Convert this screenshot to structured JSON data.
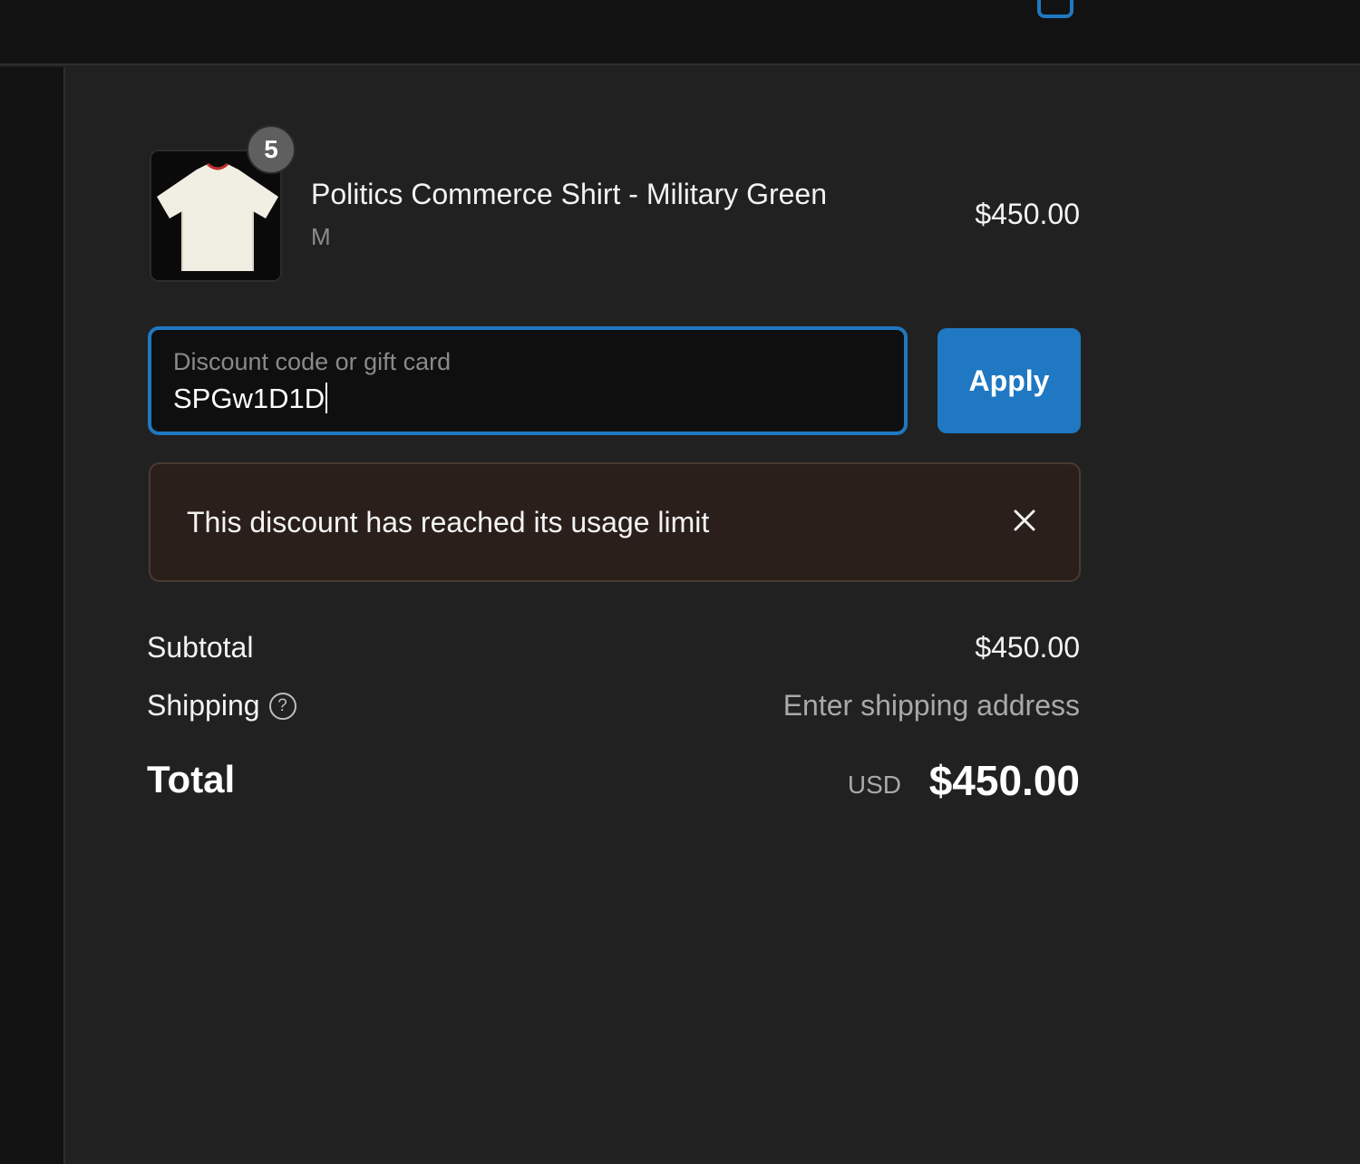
{
  "colors": {
    "accent": "#1f78c1",
    "background": "#212121",
    "topbar": "#121212",
    "error_banner_bg": "#2a1f1b"
  },
  "header": {
    "bag_icon": "shopping-bag-icon"
  },
  "cart": {
    "item": {
      "name": "Politics Commerce Shirt - Military Green",
      "variant": "M",
      "price": "$450.00",
      "quantity": "5",
      "thumbnail": "white-shirt"
    }
  },
  "discount": {
    "label": "Discount code or gift card",
    "value": "SPGw1D1D",
    "apply_label": "Apply",
    "error": "This discount has reached its usage limit"
  },
  "summary": {
    "subtotal_label": "Subtotal",
    "subtotal_value": "$450.00",
    "shipping_label": "Shipping",
    "shipping_help_icon": "?",
    "shipping_value": "Enter shipping address",
    "total_label": "Total",
    "currency": "USD",
    "total_value": "$450.00"
  }
}
